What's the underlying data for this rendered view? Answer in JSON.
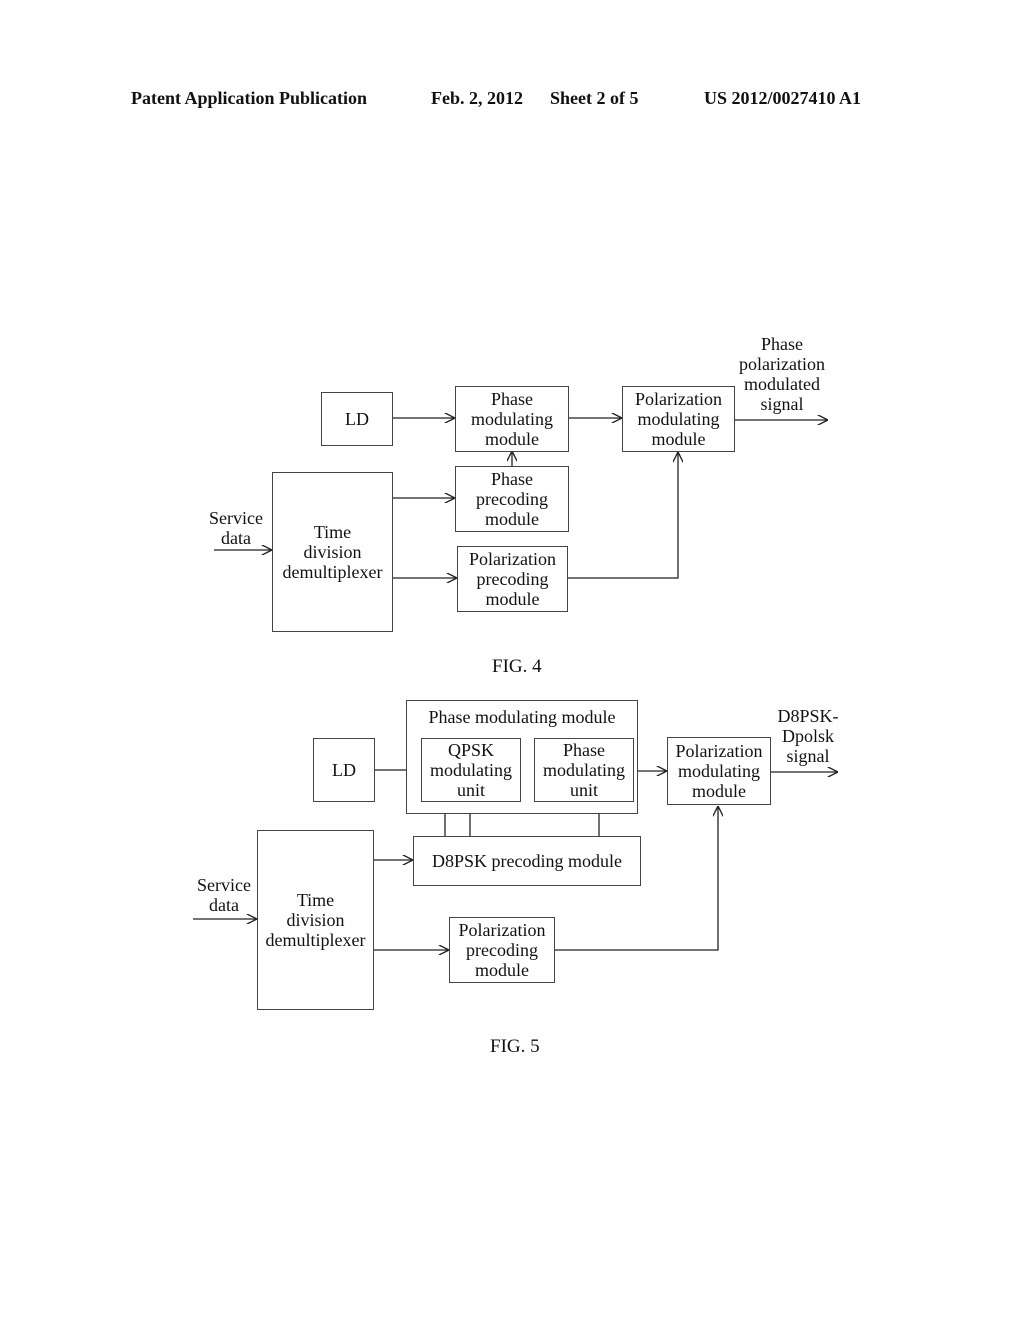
{
  "header": {
    "publication": "Patent Application Publication",
    "date": "Feb. 2, 2012",
    "sheet": "Sheet 2 of 5",
    "number": "US 2012/0027410 A1"
  },
  "fig4": {
    "caption": "FIG. 4",
    "input_label": [
      "Service",
      "data"
    ],
    "output_label": [
      "Phase",
      "polarization",
      "modulated",
      "signal"
    ],
    "ld": "LD",
    "phase_mod": [
      "Phase",
      "modulating",
      "module"
    ],
    "pol_mod": [
      "Polarization",
      "modulating",
      "module"
    ],
    "phase_pre": [
      "Phase",
      "precoding",
      "module"
    ],
    "pol_pre": [
      "Polarization",
      "precoding",
      "module"
    ],
    "tdm": [
      "Time",
      "division",
      "demultiplexer"
    ]
  },
  "fig5": {
    "caption": "FIG. 5",
    "input_label": [
      "Service",
      "data"
    ],
    "output_label": [
      "D8PSK-",
      "Dpolsk",
      "signal"
    ],
    "ld": "LD",
    "phase_mod_group": "Phase modulating module",
    "qpsk_unit": [
      "QPSK",
      "modulating",
      "unit"
    ],
    "phase_unit": [
      "Phase",
      "modulating",
      "unit"
    ],
    "pol_mod": [
      "Polarization",
      "modulating",
      "module"
    ],
    "d8psk_pre": "D8PSK precoding module",
    "pol_pre": [
      "Polarization",
      "precoding",
      "module"
    ],
    "tdm": [
      "Time",
      "division",
      "demultiplexer"
    ]
  }
}
